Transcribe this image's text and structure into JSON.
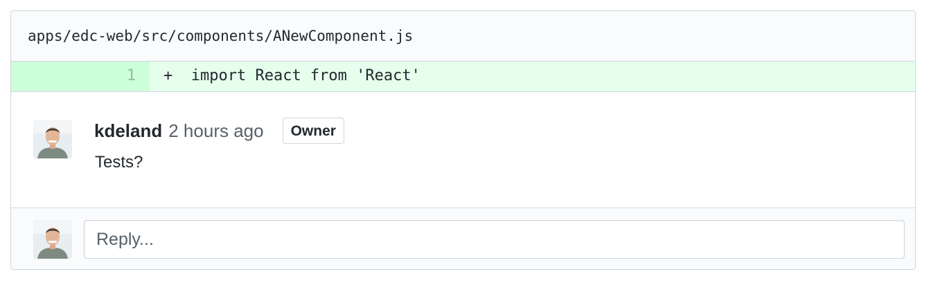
{
  "file": {
    "path": "apps/edc-web/src/components/ANewComponent.js"
  },
  "diff": {
    "lines": [
      {
        "number": "1",
        "marker": "+",
        "code": "import React from 'React'"
      }
    ]
  },
  "comment": {
    "author": "kdeland",
    "timestamp": "2 hours ago",
    "badge": "Owner",
    "body": "Tests?",
    "avatar_icon": "user-avatar"
  },
  "reply": {
    "placeholder": "Reply..."
  },
  "colors": {
    "addition_bg": "#e6ffed",
    "addition_num_bg": "#cdffd8",
    "border": "#d1d5da",
    "text": "#24292e",
    "muted": "#586069"
  }
}
